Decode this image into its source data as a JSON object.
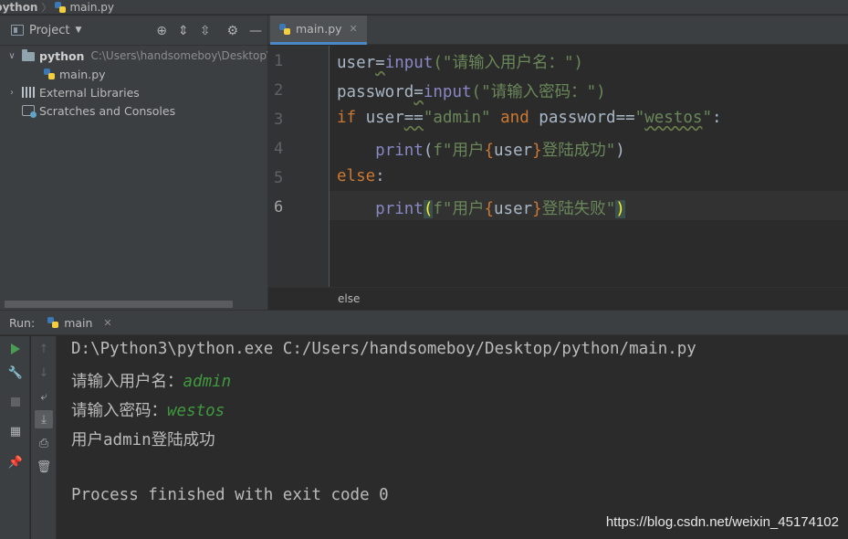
{
  "breadcrumb": {
    "root": "python",
    "file": "main.py"
  },
  "project_panel": {
    "title": "Project",
    "tree": {
      "root_name": "python",
      "root_path": "C:\\Users\\handsomeboy\\Desktop\\",
      "file": "main.py",
      "external_libraries": "External Libraries",
      "scratches": "Scratches and Consoles"
    }
  },
  "editor": {
    "tab_label": "main.py",
    "line_numbers": [
      "1",
      "2",
      "3",
      "4",
      "5",
      "6"
    ],
    "code": {
      "l1_var": "user",
      "l1_op": "=",
      "l1_fn": "input",
      "l1_str": "(\"请输入用户名：\")",
      "l2_var": "password",
      "l2_op": "=",
      "l2_fn": "input",
      "l2_str": "(\"请输入密码：\")",
      "l3_if": "if",
      "l3_var1": " user",
      "l3_eq1": "==",
      "l3_s1": "\"admin\"",
      "l3_and": " and ",
      "l3_var2": "password",
      "l3_eq2": "==",
      "l3_s2a": "\"",
      "l3_s2b": "westos",
      "l3_s2c": "\"",
      "l3_colon": ":",
      "l4_indent": "    ",
      "l4_fn": "print",
      "l4_p1": "(",
      "l4_f": "f\"用户",
      "l4_b1": "{",
      "l4_v": "user",
      "l4_b2": "}",
      "l4_s": "登陆成功\"",
      "l4_p2": ")",
      "l5_else": "else",
      "l5_colon": ":",
      "l6_indent": "    ",
      "l6_fn": "print",
      "l6_p1": "(",
      "l6_f": "f\"用户",
      "l6_b1": "{",
      "l6_v": "user",
      "l6_b2": "}",
      "l6_s": "登陆失败\"",
      "l6_p2": ")"
    },
    "footer_crumb": "else"
  },
  "run": {
    "label": "Run:",
    "tab": "main",
    "console": {
      "cmd": "D:\\Python3\\python.exe C:/Users/handsomeboy/Desktop/python/main.py",
      "prompt_user": "请输入用户名：",
      "input_user": "admin",
      "prompt_pwd": "请输入密码：",
      "input_pwd": "westos",
      "result": "用户admin登陆成功",
      "exit": "Process finished with exit code 0"
    }
  },
  "watermark": "https://blog.csdn.net/weixin_45174102",
  "colors": {
    "keyword": "#cc7832",
    "string": "#6a8759",
    "builtin": "#8888c6",
    "console_input": "#3f9a3f"
  }
}
